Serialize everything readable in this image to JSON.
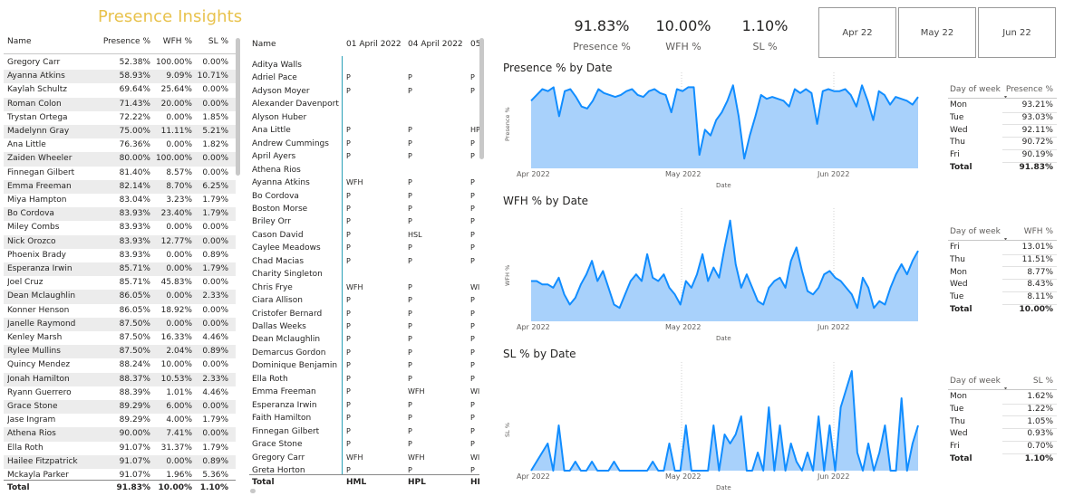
{
  "title": "Presence Insights",
  "left_table": {
    "headers": [
      "Name",
      "Presence %",
      "WFH %",
      "SL %"
    ],
    "rows": [
      [
        "Gregory Carr",
        "52.38%",
        "100.00%",
        "0.00%"
      ],
      [
        "Ayanna Atkins",
        "58.93%",
        "9.09%",
        "10.71%"
      ],
      [
        "Kaylah Schultz",
        "69.64%",
        "25.64%",
        "0.00%"
      ],
      [
        "Roman Colon",
        "71.43%",
        "20.00%",
        "0.00%"
      ],
      [
        "Trystan Ortega",
        "72.22%",
        "0.00%",
        "1.85%"
      ],
      [
        "Madelynn Gray",
        "75.00%",
        "11.11%",
        "5.21%"
      ],
      [
        "Ana Little",
        "76.36%",
        "0.00%",
        "1.82%"
      ],
      [
        "Zaiden Wheeler",
        "80.00%",
        "100.00%",
        "0.00%"
      ],
      [
        "Finnegan Gilbert",
        "81.40%",
        "8.57%",
        "0.00%"
      ],
      [
        "Emma Freeman",
        "82.14%",
        "8.70%",
        "6.25%"
      ],
      [
        "Miya Hampton",
        "83.04%",
        "3.23%",
        "1.79%"
      ],
      [
        "Bo Cordova",
        "83.93%",
        "23.40%",
        "1.79%"
      ],
      [
        "Miley Combs",
        "83.93%",
        "0.00%",
        "0.00%"
      ],
      [
        "Nick Orozco",
        "83.93%",
        "12.77%",
        "0.00%"
      ],
      [
        "Phoenix Brady",
        "83.93%",
        "0.00%",
        "0.89%"
      ],
      [
        "Esperanza Irwin",
        "85.71%",
        "0.00%",
        "1.79%"
      ],
      [
        "Joel Cruz",
        "85.71%",
        "45.83%",
        "0.00%"
      ],
      [
        "Dean Mclaughlin",
        "86.05%",
        "0.00%",
        "2.33%"
      ],
      [
        "Konner Henson",
        "86.05%",
        "18.92%",
        "0.00%"
      ],
      [
        "Janelle Raymond",
        "87.50%",
        "0.00%",
        "0.00%"
      ],
      [
        "Kenley Marsh",
        "87.50%",
        "16.33%",
        "4.46%"
      ],
      [
        "Rylee Mullins",
        "87.50%",
        "2.04%",
        "0.89%"
      ],
      [
        "Quincy Mendez",
        "88.24%",
        "10.00%",
        "0.00%"
      ],
      [
        "Jonah Hamilton",
        "88.37%",
        "10.53%",
        "2.33%"
      ],
      [
        "Ryann Guerrero",
        "88.39%",
        "1.01%",
        "4.46%"
      ],
      [
        "Grace Stone",
        "89.29%",
        "6.00%",
        "0.00%"
      ],
      [
        "Jase Ingram",
        "89.29%",
        "4.00%",
        "1.79%"
      ],
      [
        "Athena Rios",
        "90.00%",
        "7.41%",
        "0.00%"
      ],
      [
        "Ella Roth",
        "91.07%",
        "31.37%",
        "1.79%"
      ],
      [
        "Hailee Fitzpatrick",
        "91.07%",
        "0.00%",
        "0.89%"
      ],
      [
        "Mckayla Parker",
        "91.07%",
        "1.96%",
        "5.36%"
      ]
    ],
    "total": [
      "Total",
      "91.83%",
      "10.00%",
      "1.10%"
    ]
  },
  "matrix": {
    "headers": [
      "Name",
      "01 April 2022",
      "04 April 2022",
      "05"
    ],
    "rows": [
      [
        "Aditya Walls",
        "",
        "",
        ""
      ],
      [
        "Adriel Pace",
        "P",
        "P",
        "P"
      ],
      [
        "Adyson Moyer",
        "P",
        "P",
        "P"
      ],
      [
        "Alexander Davenport",
        "",
        "",
        ""
      ],
      [
        "Alyson Huber",
        "",
        "",
        ""
      ],
      [
        "Ana Little",
        "P",
        "P",
        "HP"
      ],
      [
        "Andrew Cummings",
        "P",
        "P",
        "P"
      ],
      [
        "April Ayers",
        "P",
        "P",
        "P"
      ],
      [
        "Athena Rios",
        "",
        "",
        ""
      ],
      [
        "Ayanna Atkins",
        "WFH",
        "P",
        "P"
      ],
      [
        "Bo Cordova",
        "P",
        "P",
        "P"
      ],
      [
        "Boston Morse",
        "P",
        "P",
        "P"
      ],
      [
        "Briley Orr",
        "P",
        "P",
        "P"
      ],
      [
        "Cason David",
        "P",
        "HSL",
        "P"
      ],
      [
        "Caylee Meadows",
        "P",
        "P",
        "P"
      ],
      [
        "Chad Macias",
        "P",
        "P",
        "P"
      ],
      [
        "Charity Singleton",
        "",
        "",
        ""
      ],
      [
        "Chris Frye",
        "WFH",
        "P",
        "WI"
      ],
      [
        "Ciara Allison",
        "P",
        "P",
        "P"
      ],
      [
        "Cristofer Bernard",
        "P",
        "P",
        "P"
      ],
      [
        "Dallas Weeks",
        "P",
        "P",
        "P"
      ],
      [
        "Dean Mclaughlin",
        "P",
        "P",
        "P"
      ],
      [
        "Demarcus Gordon",
        "P",
        "P",
        "P"
      ],
      [
        "Dominique Benjamin",
        "P",
        "P",
        "P"
      ],
      [
        "Ella Roth",
        "P",
        "P",
        "P"
      ],
      [
        "Emma Freeman",
        "P",
        "WFH",
        "WI"
      ],
      [
        "Esperanza Irwin",
        "P",
        "P",
        "P"
      ],
      [
        "Faith Hamilton",
        "P",
        "P",
        "P"
      ],
      [
        "Finnegan Gilbert",
        "P",
        "P",
        "P"
      ],
      [
        "Grace Stone",
        "P",
        "P",
        "P"
      ],
      [
        "Gregory Carr",
        "WFH",
        "WFH",
        "WI"
      ],
      [
        "Greta Horton",
        "P",
        "P",
        "P"
      ]
    ],
    "total": [
      "Total",
      "HML",
      "HPL",
      "HF"
    ]
  },
  "kpis": [
    {
      "value": "91.83%",
      "label": "Presence %"
    },
    {
      "value": "10.00%",
      "label": "WFH %"
    },
    {
      "value": "1.10%",
      "label": "SL %"
    }
  ],
  "slicers": [
    "Apr 22",
    "May 22",
    "Jun 22"
  ],
  "colors": {
    "accent": "#e8c24c",
    "line": "#118dff",
    "area": "#a8d1fb",
    "shade": "#ececec"
  },
  "chart_data": [
    {
      "type": "area",
      "title": "Presence % by Date",
      "xlabel": "Date",
      "ylabel": "Presence %",
      "x_ticks": [
        "Apr 2022",
        "May 2022",
        "Jun 2022"
      ],
      "values": [
        0.9,
        0.93,
        0.96,
        0.95,
        0.97,
        0.82,
        0.95,
        0.96,
        0.92,
        0.87,
        0.86,
        0.9,
        0.96,
        0.94,
        0.93,
        0.92,
        0.93,
        0.95,
        0.96,
        0.93,
        0.92,
        0.95,
        0.96,
        0.94,
        0.93,
        0.84,
        0.96,
        0.95,
        0.97,
        0.97,
        0.62,
        0.75,
        0.72,
        0.8,
        0.84,
        0.9,
        0.98,
        0.82,
        0.6,
        0.72,
        0.82,
        0.93,
        0.91,
        0.92,
        0.91,
        0.9,
        0.87,
        0.96,
        0.94,
        0.96,
        0.94,
        0.78,
        0.95,
        0.96,
        0.95,
        0.95,
        0.96,
        0.93,
        0.87,
        0.98,
        0.9,
        0.8,
        0.95,
        0.93,
        0.88,
        0.92,
        0.91,
        0.9,
        0.88,
        0.92
      ]
    },
    {
      "type": "area",
      "title": "WFH % by Date",
      "xlabel": "Date",
      "ylabel": "WFH %",
      "x_ticks": [
        "Apr 2022",
        "May 2022",
        "Jun 2022"
      ],
      "values": [
        0.12,
        0.12,
        0.11,
        0.11,
        0.1,
        0.13,
        0.08,
        0.05,
        0.07,
        0.11,
        0.14,
        0.18,
        0.12,
        0.15,
        0.1,
        0.05,
        0.04,
        0.08,
        0.12,
        0.14,
        0.12,
        0.2,
        0.13,
        0.12,
        0.14,
        0.1,
        0.08,
        0.05,
        0.12,
        0.1,
        0.14,
        0.2,
        0.12,
        0.16,
        0.13,
        0.22,
        0.3,
        0.17,
        0.1,
        0.14,
        0.1,
        0.06,
        0.05,
        0.1,
        0.12,
        0.13,
        0.1,
        0.18,
        0.22,
        0.15,
        0.09,
        0.08,
        0.1,
        0.14,
        0.15,
        0.13,
        0.12,
        0.1,
        0.08,
        0.04,
        0.13,
        0.1,
        0.04,
        0.06,
        0.05,
        0.1,
        0.14,
        0.17,
        0.14,
        0.18,
        0.21
      ]
    },
    {
      "type": "area",
      "title": "SL % by Date",
      "xlabel": "Date",
      "ylabel": "SL %",
      "x_ticks": [
        "Apr 2022",
        "May 2022",
        "Jun 2022"
      ],
      "values": [
        0.0,
        0.01,
        0.02,
        0.03,
        0.0,
        0.05,
        0.0,
        0.0,
        0.01,
        0.0,
        0.0,
        0.01,
        0.0,
        0.0,
        0.0,
        0.01,
        0.0,
        0.0,
        0.0,
        0.0,
        0.0,
        0.0,
        0.01,
        0.0,
        0.0,
        0.03,
        0.0,
        0.0,
        0.05,
        0.0,
        0.0,
        0.0,
        0.0,
        0.05,
        0.0,
        0.04,
        0.03,
        0.04,
        0.06,
        0.0,
        0.0,
        0.02,
        0.0,
        0.07,
        0.0,
        0.05,
        0.0,
        0.03,
        0.01,
        0.0,
        0.02,
        0.0,
        0.06,
        0.0,
        0.05,
        0.0,
        0.07,
        0.09,
        0.11,
        0.02,
        0.0,
        0.03,
        0.0,
        0.02,
        0.05,
        0.0,
        0.0,
        0.08,
        0.0,
        0.03,
        0.05
      ]
    }
  ],
  "mini_tables": [
    {
      "headers": [
        "Day of week",
        "Presence %"
      ],
      "rows": [
        [
          "Mon",
          "93.21%"
        ],
        [
          "Tue",
          "93.03%"
        ],
        [
          "Wed",
          "92.11%"
        ],
        [
          "Thu",
          "90.72%"
        ],
        [
          "Fri",
          "90.19%"
        ]
      ],
      "total": [
        "Total",
        "91.83%"
      ]
    },
    {
      "headers": [
        "Day of week",
        "WFH %"
      ],
      "rows": [
        [
          "Fri",
          "13.01%"
        ],
        [
          "Thu",
          "11.51%"
        ],
        [
          "Mon",
          "8.77%"
        ],
        [
          "Wed",
          "8.43%"
        ],
        [
          "Tue",
          "8.11%"
        ]
      ],
      "total": [
        "Total",
        "10.00%"
      ]
    },
    {
      "headers": [
        "Day of week",
        "SL %"
      ],
      "rows": [
        [
          "Mon",
          "1.62%"
        ],
        [
          "Tue",
          "1.22%"
        ],
        [
          "Thu",
          "1.05%"
        ],
        [
          "Wed",
          "0.93%"
        ],
        [
          "Fri",
          "0.70%"
        ]
      ],
      "total": [
        "Total",
        "1.10%"
      ]
    }
  ]
}
